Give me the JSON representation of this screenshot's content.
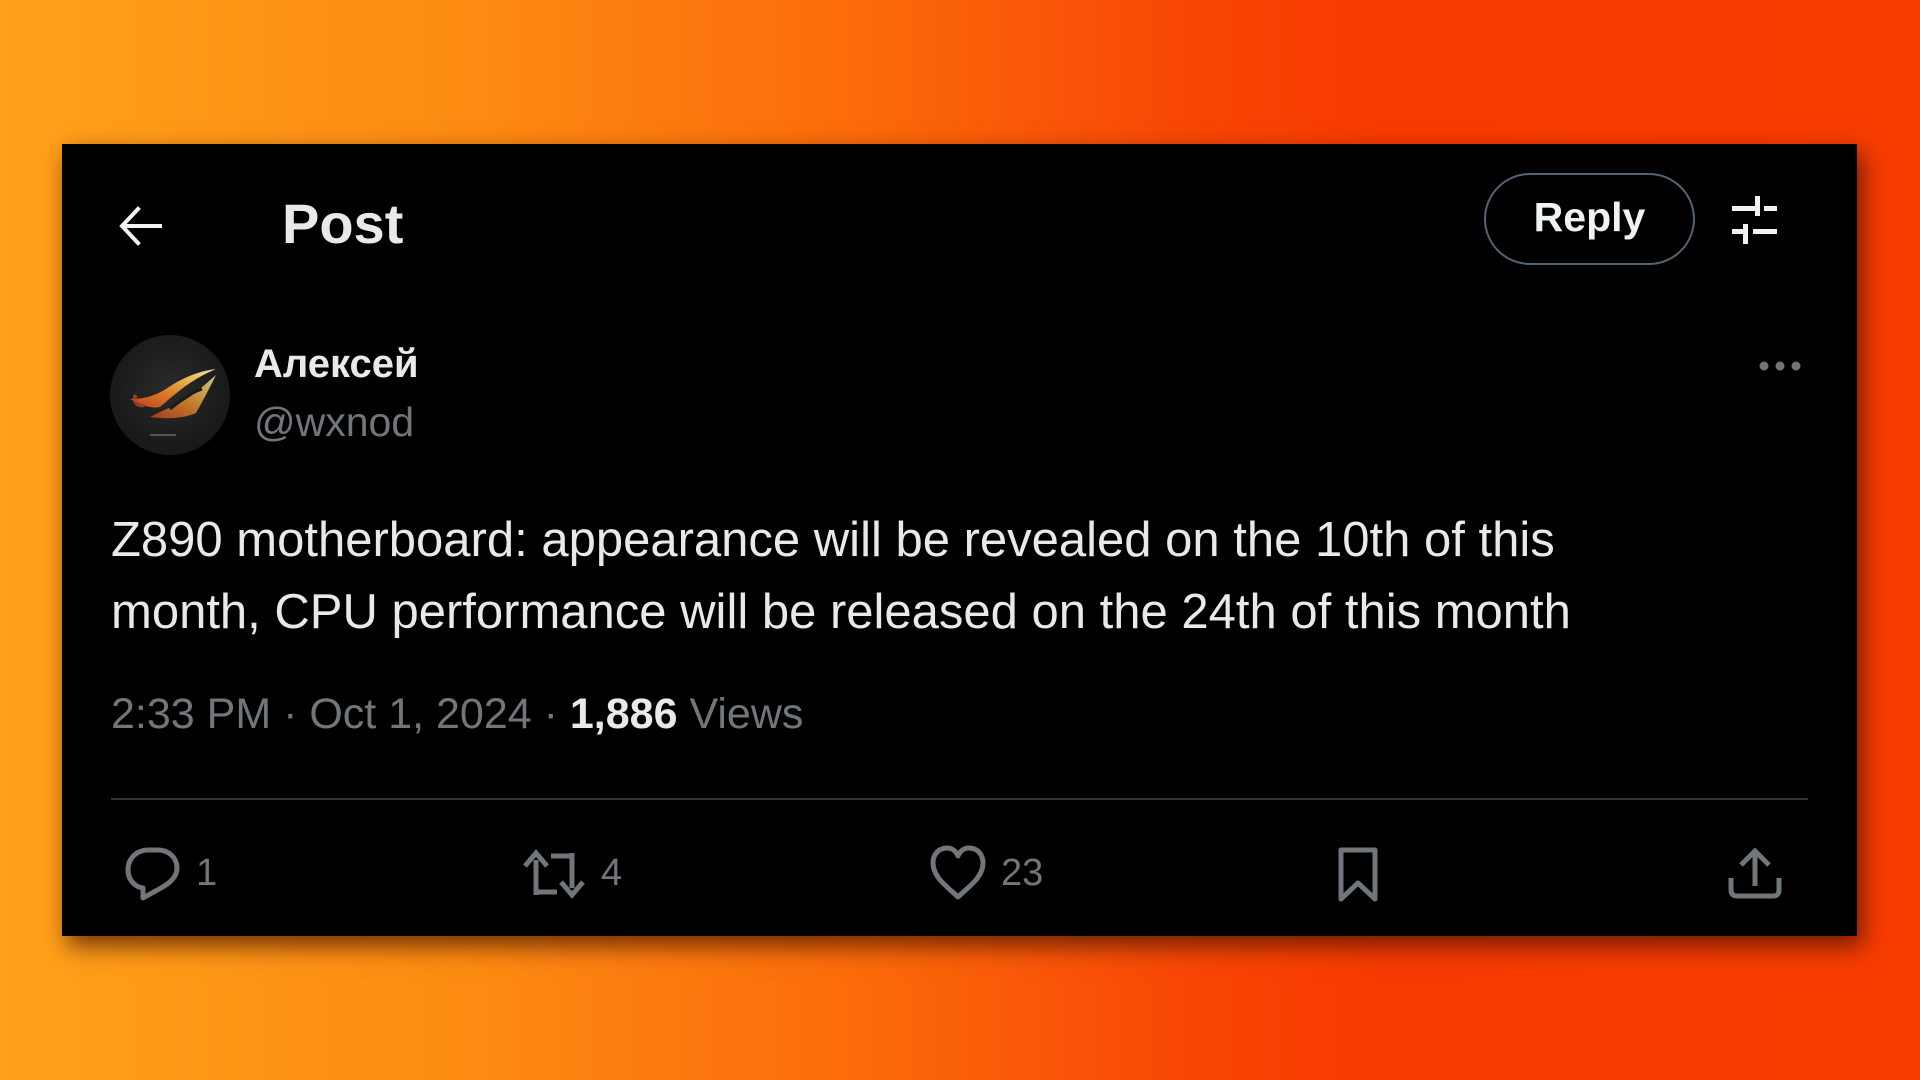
{
  "header": {
    "back_icon": "arrow-left-icon",
    "title": "Post",
    "reply_button_label": "Reply",
    "settings_icon": "sliders-icon"
  },
  "author": {
    "display_name": "Алексей",
    "handle": "@wxnod",
    "avatar_icon": "rog-logo-avatar",
    "more_icon": "more-horizontal-icon"
  },
  "post": {
    "text": "Z890 motherboard: appearance will be revealed on the 10th of this month, CPU performance will be released on the 24th of this month",
    "lines": [
      "Z890 motherboard: appearance will be revealed on the 10th of this",
      "month, CPU performance will be released on the 24th of this month"
    ],
    "time": "2:33 PM",
    "separator": " · ",
    "date": "Oct 1, 2024",
    "views_count": "1,886",
    "views_label": "Views"
  },
  "actions": {
    "reply": {
      "icon": "reply-bubble-icon",
      "count": "1"
    },
    "retweet": {
      "icon": "retweet-icon",
      "count": "4"
    },
    "like": {
      "icon": "heart-icon",
      "count": "23"
    },
    "bookmark": {
      "icon": "bookmark-icon"
    },
    "share": {
      "icon": "share-upload-icon"
    }
  },
  "colors": {
    "card_background": "#000000",
    "primary_text": "#e7e9ea",
    "secondary_text": "#71767b",
    "button_border": "#536471",
    "divider": "#2f3336",
    "background_gradient_start": "#ffa11b",
    "background_gradient_end": "#f83c00"
  }
}
